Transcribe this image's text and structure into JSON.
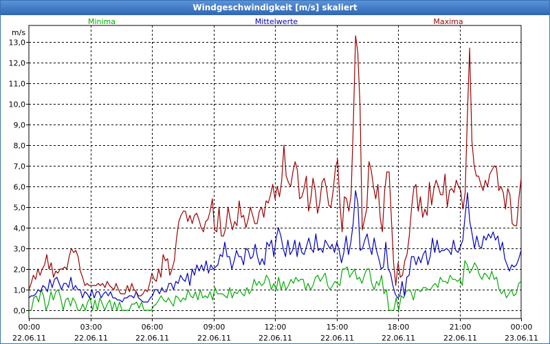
{
  "window": {
    "title": "Windgeschwindigkeit [m/s] skaliert"
  },
  "colors": {
    "min": "#00aa00",
    "mean": "#0000bb",
    "max": "#990000",
    "grid": "#000000"
  },
  "chart_data": {
    "type": "line",
    "title": "Windgeschwindigkeit [m/s] skaliert",
    "ylabel": "m/s",
    "ylim": [
      -0.4,
      13.8
    ],
    "xlim": [
      0,
      24
    ],
    "y_ticks": [
      "0,0",
      "1,0",
      "2,0",
      "3,0",
      "4,0",
      "5,0",
      "6,0",
      "7,0",
      "8,0",
      "9,0",
      "10,0",
      "11,0",
      "12,0",
      "13,0"
    ],
    "y_tick_values": [
      0,
      1,
      2,
      3,
      4,
      5,
      6,
      7,
      8,
      9,
      10,
      11,
      12,
      13
    ],
    "x_ticks": [
      {
        "time": "00:00",
        "date": "22.06.11",
        "hour": 0
      },
      {
        "time": "03:00",
        "date": "22.06.11",
        "hour": 3
      },
      {
        "time": "06:00",
        "date": "22.06.11",
        "hour": 6
      },
      {
        "time": "09:00",
        "date": "22.06.11",
        "hour": 9
      },
      {
        "time": "12:00",
        "date": "22.06.11",
        "hour": 12
      },
      {
        "time": "15:00",
        "date": "22.06.11",
        "hour": 15
      },
      {
        "time": "18:00",
        "date": "22.06.11",
        "hour": 18
      },
      {
        "time": "21:00",
        "date": "22.06.11",
        "hour": 21
      },
      {
        "time": "00:00",
        "date": "23.06.11",
        "hour": 24
      }
    ],
    "grid": true,
    "x_interval_hours": 0.1667,
    "series": [
      {
        "name": "Minima",
        "color": "#00aa00",
        "values": [
          0.0,
          0.0,
          0.6,
          0.7,
          0.4,
          1.0,
          0.7,
          0.0,
          0.3,
          0.9,
          0.5,
          0.9,
          1.0,
          0.6,
          0.0,
          0.5,
          0.6,
          0.2,
          0.6,
          0.4,
          0.0,
          0.0,
          0.3,
          0.0,
          0.4,
          0.6,
          0.0,
          0.5,
          0.0,
          0.6,
          0.3,
          0.0,
          0.3,
          0.5,
          0.0,
          0.4,
          0.0,
          0.4,
          0.0,
          0.0,
          0.0,
          0.0,
          0.3,
          0.3,
          0.4,
          0.1,
          0.4,
          0.0,
          0.0,
          0.0,
          0.0,
          0.2,
          0.3,
          0.5,
          0.7,
          0.5,
          0.4,
          0.6,
          0.4,
          0.2,
          0.7,
          0.6,
          0.4,
          0.6,
          0.5,
          1.0,
          0.7,
          0.6,
          0.9,
          0.5,
          1.0,
          0.6,
          0.7,
          0.6,
          0.9,
          0.5,
          1.1,
          0.8,
          0.8,
          0.8,
          0.7,
          0.6,
          1.1,
          0.6,
          0.9,
          0.8,
          1.0,
          0.8,
          0.7,
          1.1,
          0.8,
          1.0,
          1.5,
          1.2,
          1.4,
          1.2,
          1.3,
          1.7,
          1.5,
          1.0,
          1.3,
          1.0,
          1.6,
          1.0,
          1.4,
          1.0,
          1.2,
          1.5,
          1.3,
          1.6,
          1.4,
          1.5,
          1.5,
          1.0,
          1.3,
          1.0,
          1.2,
          1.6,
          1.7,
          1.4,
          1.6,
          1.8,
          1.2,
          1.0,
          1.2,
          1.4,
          1.3,
          1.2,
          2.0,
          2.0,
          2.1,
          1.6,
          1.8,
          2.0,
          1.5,
          1.6,
          1.3,
          1.7,
          2.0,
          2.0,
          1.3,
          1.0,
          1.4,
          1.2,
          1.7,
          0.8,
          1.0,
          0.0,
          0.0,
          0.0,
          0.6,
          0.0,
          0.7,
          0.6,
          0.9,
          1.0,
          0.9,
          0.5,
          1.0,
          1.0,
          0.9,
          1.1,
          1.1,
          1.0,
          1.0,
          1.2,
          1.3,
          1.1,
          1.6,
          1.4,
          1.4,
          1.3,
          1.7,
          1.5,
          1.5,
          1.4,
          1.5,
          1.2,
          2.4,
          2.2,
          1.8,
          2.0,
          2.3,
          2.1,
          1.7,
          1.5,
          1.8,
          1.7,
          1.5,
          1.9,
          1.5,
          1.6,
          1.0,
          0.8,
          1.0,
          0.6,
          0.8,
          1.0,
          0.7,
          0.8,
          1.3,
          1.4
        ]
      },
      {
        "name": "Mittelwerte",
        "color": "#0000bb",
        "values": [
          0.6,
          0.7,
          0.7,
          0.8,
          1.0,
          0.9,
          1.2,
          1.1,
          0.9,
          1.5,
          1.1,
          1.5,
          1.6,
          1.3,
          1.0,
          1.3,
          1.3,
          1.1,
          1.6,
          1.0,
          1.2,
          1.0,
          1.0,
          0.6,
          0.9,
          0.8,
          0.6,
          1.0,
          0.6,
          0.9,
          0.9,
          0.6,
          0.8,
          0.9,
          0.7,
          0.9,
          0.6,
          0.6,
          0.5,
          0.5,
          0.4,
          0.6,
          0.6,
          0.7,
          0.7,
          0.6,
          0.9,
          0.6,
          0.5,
          0.4,
          0.4,
          0.4,
          0.6,
          0.7,
          1.0,
          1.0,
          0.8,
          1.1,
          0.9,
          0.9,
          1.3,
          1.3,
          1.0,
          1.4,
          1.3,
          1.7,
          1.5,
          1.4,
          1.8,
          1.2,
          2.0,
          1.7,
          2.2,
          1.9,
          2.2,
          1.9,
          2.4,
          1.8,
          2.2,
          2.0,
          2.1,
          2.2,
          2.7,
          2.6,
          3.3,
          2.6,
          2.6,
          2.0,
          2.4,
          2.9,
          2.6,
          2.6,
          2.2,
          3.0,
          2.9,
          2.5,
          2.6,
          3.2,
          2.6,
          2.2,
          2.5,
          2.2,
          3.3,
          3.1,
          3.4,
          2.6,
          3.5,
          4.0,
          3.6,
          3.0,
          2.6,
          3.4,
          2.7,
          2.9,
          3.4,
          2.6,
          3.3,
          2.8,
          2.7,
          3.1,
          3.5,
          3.0,
          2.8,
          3.7,
          2.9,
          3.0,
          2.8,
          3.4,
          3.2,
          3.0,
          3.2,
          2.8,
          3.3,
          2.9,
          2.3,
          2.8,
          3.6,
          2.7,
          3.3,
          4.2,
          5.8,
          5.2,
          2.9,
          3.0,
          3.4,
          3.7,
          3.1,
          2.7,
          3.5,
          2.9,
          2.5,
          2.0,
          2.1,
          3.3,
          2.0,
          1.8,
          1.2,
          0.8,
          0.6,
          0.7,
          1.4,
          0.7,
          1.6,
          1.7,
          2.6,
          2.6,
          2.2,
          2.6,
          2.3,
          2.7,
          2.9,
          2.2,
          2.6,
          3.5,
          2.8,
          3.4,
          2.8,
          2.9,
          2.9,
          3.0,
          2.9,
          2.7,
          3.4,
          2.9,
          2.8,
          3.1,
          3.4,
          4.6,
          5.7,
          4.3,
          3.7,
          3.0,
          3.6,
          3.1,
          3.0,
          3.6,
          3.4,
          3.7,
          3.5,
          3.8,
          3.4,
          3.6,
          2.9,
          3.3,
          2.5,
          2.2,
          1.9,
          2.2,
          2.1,
          2.2,
          2.5,
          2.9
        ]
      },
      {
        "name": "Maxima",
        "color": "#990000",
        "values": [
          1.0,
          1.3,
          1.7,
          1.5,
          2.0,
          1.7,
          2.0,
          2.2,
          2.7,
          2.0,
          2.3,
          1.6,
          1.9,
          1.8,
          2.0,
          2.0,
          2.1,
          2.0,
          2.6,
          3.0,
          2.8,
          2.9,
          2.6,
          1.9,
          1.6,
          1.2,
          1.3,
          1.2,
          1.2,
          1.2,
          1.2,
          1.3,
          1.2,
          1.3,
          1.1,
          1.4,
          1.2,
          1.1,
          1.0,
          1.3,
          1.0,
          0.8,
          0.8,
          0.8,
          1.2,
          0.9,
          1.3,
          1.0,
          0.9,
          0.7,
          0.7,
          0.8,
          1.0,
          0.9,
          1.3,
          1.8,
          1.5,
          1.4,
          2.0,
          1.6,
          2.7,
          2.4,
          2.5,
          1.7,
          2.0,
          2.4,
          3.5,
          4.3,
          4.6,
          4.8,
          4.8,
          4.3,
          4.6,
          4.2,
          4.6,
          4.7,
          4.4,
          4.0,
          3.8,
          4.3,
          4.4,
          4.8,
          5.4,
          3.9,
          3.8,
          5.0,
          3.6,
          3.6,
          4.0,
          5.0,
          4.4,
          3.9,
          4.3,
          4.1,
          5.3,
          4.5,
          4.6,
          4.0,
          4.4,
          5.0,
          4.6,
          4.2,
          4.2,
          4.8,
          5.0,
          4.5,
          5.3,
          5.2,
          5.6,
          6.1,
          5.4,
          6.0,
          5.5,
          6.3,
          8.0,
          6.5,
          6.2,
          6.0,
          6.7,
          7.2,
          6.8,
          5.4,
          5.5,
          5.9,
          6.5,
          4.8,
          5.4,
          6.4,
          5.8,
          4.7,
          5.2,
          6.2,
          6.4,
          5.9,
          5.1,
          5.0,
          5.8,
          6.9,
          7.3,
          5.2,
          3.8,
          5.5,
          5.4,
          4.8,
          5.6,
          9.0,
          13.3,
          12.5,
          9.9,
          3.9,
          4.4,
          4.9,
          7.2,
          6.8,
          6.0,
          5.4,
          6.1,
          4.5,
          3.8,
          5.8,
          6.7,
          6.7,
          4.5,
          2.3,
          1.2,
          2.3,
          1.6,
          1.7,
          2.4,
          2.7,
          3.6,
          4.9,
          5.9,
          6.1,
          4.8,
          5.5,
          4.5,
          4.9,
          4.6,
          6.2,
          5.1,
          5.9,
          6.3,
          6.0,
          5.6,
          5.6,
          6.6,
          5.0,
          5.8,
          5.9,
          5.7,
          6.3,
          6.0,
          5.8,
          4.9,
          5.7,
          9.5,
          12.7,
          8.2,
          7.0,
          6.5,
          6.5,
          6.1,
          5.8,
          6.3,
          6.0,
          6.6,
          6.8,
          7.0,
          6.9,
          5.8,
          6.0,
          5.7,
          4.9,
          5.9,
          5.6,
          4.2,
          4.1,
          4.1,
          5.4,
          6.4
        ]
      }
    ]
  }
}
